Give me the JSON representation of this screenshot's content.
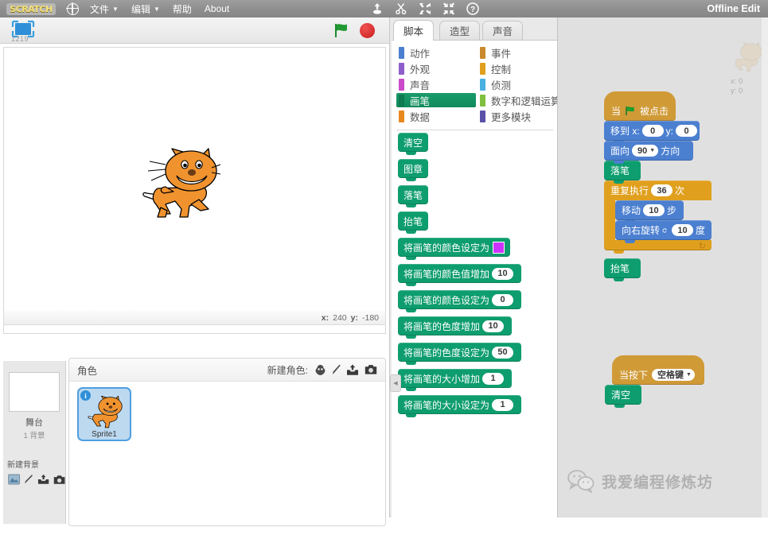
{
  "menubar": {
    "logo": "SCRATCH",
    "items": [
      {
        "label": "文件",
        "has_caret": true
      },
      {
        "label": "编辑",
        "has_caret": true
      },
      {
        "label": "帮助",
        "has_caret": false
      },
      {
        "label": "About",
        "has_caret": false
      }
    ],
    "tool_icons": [
      "share-icon",
      "scissors-icon",
      "grow-icon",
      "shrink-icon",
      "help-icon"
    ],
    "globe_icon": "globe-icon",
    "status": "Offline Edit"
  },
  "stage": {
    "presentation_icon": "presentation-mode-icon",
    "presentation_number": "1219",
    "green_flag_icon": "green-flag-icon",
    "stop_icon": "stop-button-icon",
    "sprite_on_stage": "scratch-cat",
    "coords": {
      "x_label": "x:",
      "x_value": "240",
      "y_label": "y:",
      "y_value": "-180"
    }
  },
  "stage_panel": {
    "name": "舞台",
    "backdrop_count": "1 背景",
    "new_backdrop_label": "新建背景",
    "icons": [
      "picture-icon",
      "paint-icon",
      "upload-icon",
      "camera-icon"
    ]
  },
  "sprite_panel": {
    "title": "角色",
    "new_sprite_label": "新建角色:",
    "icons": [
      "choose-sprite-icon",
      "paint-sprite-icon",
      "upload-sprite-icon",
      "camera-sprite-icon"
    ],
    "sprites": [
      {
        "name": "Sprite1",
        "badge": "i",
        "selected": true
      }
    ]
  },
  "palette": {
    "tabs": [
      {
        "label": "脚本",
        "active": true
      },
      {
        "label": "造型",
        "active": false
      },
      {
        "label": "声音",
        "active": false
      }
    ],
    "categories_left": [
      {
        "label": "动作",
        "color": "#4b7fd0",
        "selected": false
      },
      {
        "label": "外观",
        "color": "#8e5ecb",
        "selected": false
      },
      {
        "label": "声音",
        "color": "#c94bc9",
        "selected": false
      },
      {
        "label": "画笔",
        "color": "#0e9d6e",
        "selected": true
      },
      {
        "label": "数据",
        "color": "#e8871e",
        "selected": false
      }
    ],
    "categories_right": [
      {
        "label": "事件",
        "color": "#c98a2e",
        "selected": false
      },
      {
        "label": "控制",
        "color": "#e0a01e",
        "selected": false
      },
      {
        "label": "侦测",
        "color": "#49b0e0",
        "selected": false
      },
      {
        "label": "数字和逻辑运算",
        "color": "#7fbf3f",
        "selected": false
      },
      {
        "label": "更多模块",
        "color": "#5a50a8",
        "selected": false
      }
    ],
    "annotation_arrow": "red-arrow-pointing-left",
    "blocks": [
      {
        "text": "清空",
        "inputs": []
      },
      {
        "text": "图章",
        "inputs": []
      },
      {
        "text": "落笔",
        "inputs": []
      },
      {
        "text": "抬笔",
        "inputs": []
      },
      {
        "text": "将画笔的颜色设定为",
        "inputs": [
          {
            "type": "color",
            "value": "#cc33ff"
          }
        ]
      },
      {
        "text": "将画笔的颜色值增加",
        "inputs": [
          {
            "type": "number",
            "value": "10"
          }
        ]
      },
      {
        "text": "将画笔的颜色设定为",
        "inputs": [
          {
            "type": "number",
            "value": "0"
          }
        ]
      },
      {
        "text": "将画笔的色度增加",
        "inputs": [
          {
            "type": "number",
            "value": "10"
          }
        ]
      },
      {
        "text": "将画笔的色度设定为",
        "inputs": [
          {
            "type": "number",
            "value": "50"
          }
        ]
      },
      {
        "text": "将画笔的大小增加",
        "inputs": [
          {
            "type": "number",
            "value": "1"
          }
        ]
      },
      {
        "text": "将画笔的大小设定为",
        "inputs": [
          {
            "type": "number",
            "value": "1"
          }
        ]
      }
    ]
  },
  "script_area": {
    "sprite_watermark": "scratch-cat-watermark",
    "watermark_coords": [
      "x: 0",
      "y: 0"
    ],
    "script1": {
      "hat": {
        "prefix": "当",
        "icon": "green-flag-icon",
        "suffix": "被点击"
      },
      "blocks": [
        {
          "kind": "motion",
          "label_a": "移到 x:",
          "value_a": "0",
          "label_b": "y:",
          "value_b": "0"
        },
        {
          "kind": "motion",
          "label_a": "面向",
          "value_a": "90",
          "label_b": "方向",
          "dropdown": true
        },
        {
          "kind": "pen",
          "label_a": "落笔"
        }
      ],
      "loop": {
        "prefix": "重复执行",
        "count": "36",
        "suffix": "次",
        "inner": [
          {
            "kind": "motion",
            "label_a": "移动",
            "value_a": "10",
            "label_b": "步"
          },
          {
            "kind": "motion",
            "label_a": "向右旋转",
            "icon": "turn-right-icon",
            "value_a": "10",
            "label_b": "度"
          }
        ]
      },
      "after_loop": [
        {
          "kind": "pen",
          "label_a": "抬笔"
        }
      ]
    },
    "script2": {
      "hat": {
        "prefix": "当按下",
        "key": "空格键",
        "dropdown": true
      },
      "blocks": [
        {
          "kind": "pen",
          "label_a": "清空"
        }
      ]
    }
  },
  "watermark": {
    "icon": "wechat-icon",
    "text": "我爱编程修炼坊"
  }
}
